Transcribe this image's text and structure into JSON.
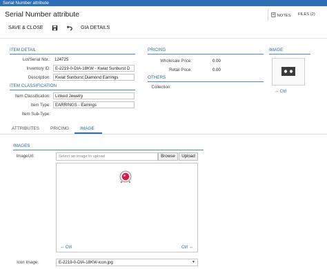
{
  "window": {
    "title": "Serial Number attribute"
  },
  "header": {
    "screen_title": "Serial Number attribute",
    "notes_label": "NOTES",
    "files_label": "FILES (2)"
  },
  "toolbar": {
    "save_close_label": "SAVE & CLOSE",
    "gia_details_label": "GIA DETAILS"
  },
  "item_detail": {
    "title": "ITEM DETAIL",
    "fields": [
      {
        "label": "Lot/Serial Nbr.:",
        "value": "124725"
      },
      {
        "label": "Inventory ID:",
        "value": "E-2219-0-DIA-18KW - Kwiat Sunburst D"
      },
      {
        "label": "Description:",
        "value": "Kwiat Sunburst Diamond Earrings"
      }
    ]
  },
  "item_classification": {
    "title": "ITEM CLASSIFICATION",
    "fields": [
      {
        "label": "Item Classification:",
        "value": "Linked Jewelry"
      },
      {
        "label": "Item Type:",
        "value": "EARRINGS - Earrings"
      },
      {
        "label": "Item Sub-Type:",
        "value": ""
      }
    ]
  },
  "pricing": {
    "title": "PRICING",
    "fields": [
      {
        "label": "Wholesale Price:",
        "value": "0.00"
      },
      {
        "label": "Retail Price:",
        "value": "0.00"
      }
    ]
  },
  "others": {
    "title": "OTHERS",
    "fields": [
      {
        "label": "Collection:",
        "value": ""
      }
    ]
  },
  "image_panel": {
    "title": "IMAGE",
    "ctrl_label": "Ctrl"
  },
  "tabs": [
    {
      "label": "ATTRIBUTES",
      "active": false
    },
    {
      "label": "PRICING",
      "active": false
    },
    {
      "label": "IMAGE",
      "active": true
    }
  ],
  "images_section": {
    "title": "IMAGES",
    "image_url_label": "ImageUrl:",
    "image_url_placeholder": "Select an image to upload",
    "browse_label": "Browse",
    "upload_label": "Upload",
    "ctrl_left": "Ctrl",
    "ctrl_right": "Ctrl",
    "icon_image_label": "Icon Image:",
    "icon_image_value": "E-2219-0-DIA-18KW-icon.jpg"
  },
  "colors": {
    "accent": "#2d6fb7",
    "link": "#2c6aa8",
    "gem": "#d81b4a"
  },
  "icons": [
    "notes-icon",
    "files-icon",
    "save-icon",
    "undo-icon",
    "chevron-down-icon",
    "scale-icon"
  ]
}
